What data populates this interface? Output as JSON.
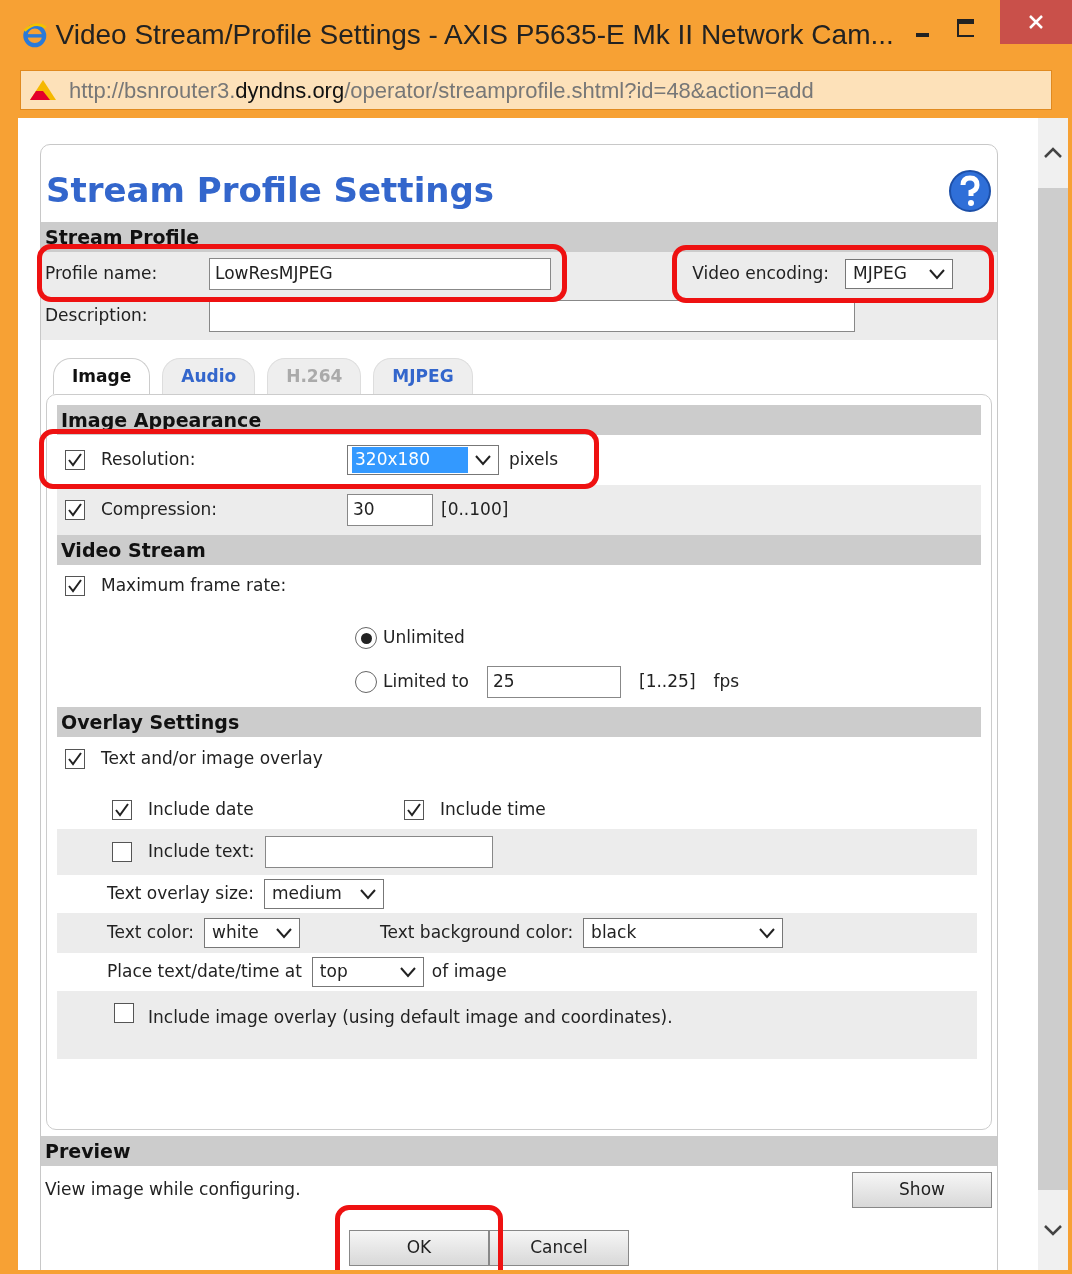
{
  "window": {
    "title": "Video Stream/Profile Settings - AXIS P5635-E Mk II Network Cam...",
    "url_start": "http://bsnrouter3.",
    "url_domain": "dyndns.org",
    "url_path": "/operator/streamprofile.shtml?id=48&action=add"
  },
  "heading": "Stream Profile Settings",
  "stream_profile": {
    "title": "Stream Profile",
    "profile_name": {
      "label": "Profile name:",
      "value": "LowResMJPEG",
      "highlighted": true
    },
    "video_encoding": {
      "label": "Video encoding:",
      "value": "MJPEG",
      "highlighted": true
    },
    "description": {
      "label": "Description:"
    }
  },
  "tabs": [
    {
      "label": "Image",
      "selected": true,
      "disabled": false
    },
    {
      "label": "Audio",
      "selected": false,
      "disabled": false
    },
    {
      "label": "H.264",
      "selected": false,
      "disabled": true
    },
    {
      "label": "MJPEG",
      "selected": false,
      "disabled": false
    }
  ],
  "image_appearance": {
    "title": "Image Appearance",
    "resolution": {
      "label": "Resolution:",
      "checked": true,
      "value": "320x180",
      "focused": true,
      "unit": "pixels",
      "highlighted": true
    },
    "compression": {
      "label": "Compression:",
      "checked": true,
      "value": "30",
      "range": "[0..100]"
    }
  },
  "video_stream": {
    "title": "Video Stream",
    "max_frame_rate": {
      "label": "Maximum frame rate:",
      "checked": true
    },
    "options": [
      {
        "label": "Unlimited",
        "selected": true
      },
      {
        "label": "Limited to",
        "selected": false
      }
    ],
    "limit_value": "25",
    "range": "[1..25]",
    "unit": "fps"
  },
  "overlay": {
    "title": "Overlay Settings",
    "text_image_overlay": {
      "label": "Text and/or image overlay",
      "checked": true
    },
    "include_date": {
      "label": "Include date",
      "checked": true
    },
    "include_time": {
      "label": "Include time",
      "checked": true
    },
    "include_text": {
      "label": "Include text:",
      "checked": false
    },
    "overlay_size": {
      "label": "Text overlay size:",
      "value": "medium"
    },
    "text_color": {
      "label": "Text color:",
      "value": "white"
    },
    "background_color": {
      "label": "Text background color:",
      "value": "black"
    },
    "position": {
      "label": "Place text/date/time at",
      "value": "top",
      "suffix": "of image"
    },
    "image_overlay": {
      "label": "Include image overlay (using default image and coordinates).",
      "checked": false
    }
  },
  "preview": {
    "title": "Preview",
    "text": "View image while configuring.",
    "button": "Show"
  },
  "buttons": [
    {
      "label": "OK",
      "highlighted": true
    },
    {
      "label": "Cancel",
      "highlighted": false
    }
  ]
}
